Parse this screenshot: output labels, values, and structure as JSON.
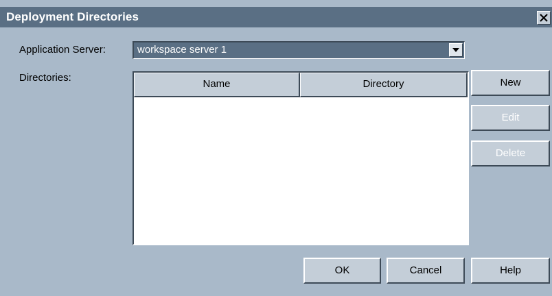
{
  "window": {
    "title": "Deployment Directories",
    "close_glyph": "X"
  },
  "form": {
    "app_server_label": "Application Server:",
    "app_server_value": "workspace server 1",
    "directories_label": "Directories:"
  },
  "table": {
    "columns": [
      "Name",
      "Directory"
    ],
    "rows": []
  },
  "side_buttons": {
    "new_label": "New",
    "edit_label": "Edit",
    "delete_label": "Delete"
  },
  "footer_buttons": {
    "ok_label": "OK",
    "cancel_label": "Cancel",
    "help_label": "Help"
  },
  "icons": {
    "combo_arrow": "chevron-down-icon",
    "close": "close-icon"
  },
  "colors": {
    "background": "#a9b9c9",
    "titlebar": "#5a6f84",
    "selection": "#5a6f84",
    "button_face": "#c4ced8"
  }
}
